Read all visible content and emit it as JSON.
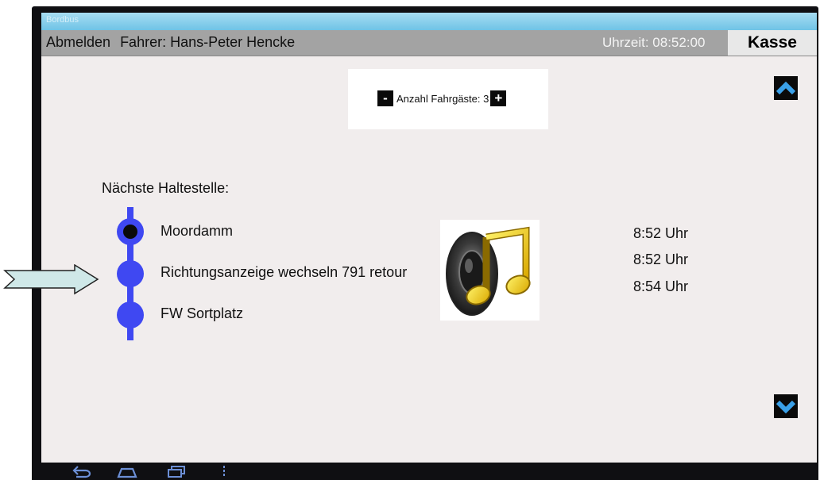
{
  "window": {
    "title": "Bordbus"
  },
  "header": {
    "logout_label": "Abmelden",
    "driver_label": "Fahrer: Hans-Peter Hencke",
    "clock_label": "Uhrzeit: 08:52:00",
    "cash_label": "Kasse"
  },
  "passengers": {
    "minus_label": "-",
    "count_label": "Anzahl Fahrgäste: 3",
    "plus_label": "+"
  },
  "stops_heading": "Nächste Haltestelle:",
  "stops": [
    {
      "name": "Moordamm",
      "time": "8:52 Uhr",
      "current": true
    },
    {
      "name": "Richtungsanzeige wechseln 791 retour",
      "time": "8:52 Uhr",
      "current": false
    },
    {
      "name": "FW Sortplatz",
      "time": "8:54 Uhr",
      "current": false
    }
  ],
  "icons": {
    "scroll_up": "chevron-up-icon",
    "scroll_down": "chevron-down-icon",
    "sound": "speaker-music-icon",
    "nav": [
      "back-icon",
      "home-icon",
      "recent-apps-icon",
      "menu-icon"
    ],
    "pointer": "right-arrow-icon"
  },
  "colors": {
    "timeline": "#3f48f2",
    "chevron": "#3aa0e8",
    "header_bg": "#a3a3a3",
    "content_bg": "#f1eded",
    "pointer_fill": "#cfe8e8"
  }
}
